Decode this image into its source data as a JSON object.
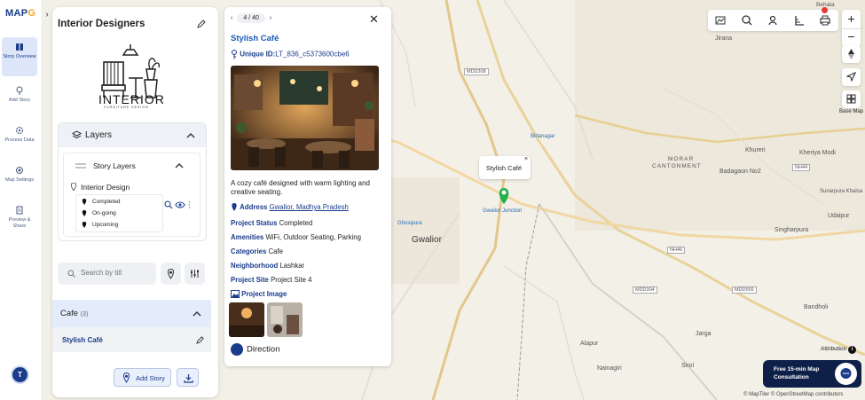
{
  "app": {
    "logo_text": "MAP",
    "logo_accent": "G",
    "logo_after": ""
  },
  "rail": {
    "items": [
      {
        "label": "Story Overview",
        "icon": "book-icon"
      },
      {
        "label": "Add Story",
        "icon": "pin-icon"
      },
      {
        "label": "Process Data",
        "icon": "gear-icon"
      },
      {
        "label": "Map Settings",
        "icon": "settings-icon"
      },
      {
        "label": "Preview & Share",
        "icon": "document-icon"
      }
    ],
    "avatar_initial": "T"
  },
  "panel": {
    "title": "Interior Designers",
    "brand_text": "INTERIOR",
    "brand_subtext": "FURNITURE DESIGN",
    "layers_label": "Layers",
    "story_layers_label": "Story Layers",
    "layer_name": "Interior Design",
    "statuses": [
      "Completed",
      "On-going",
      "Upcoming"
    ],
    "search_placeholder": "Search by titl",
    "category": {
      "name": "Cafe",
      "count": "(3)"
    },
    "category_item": "Stylish Café",
    "add_story_label": "Add Story"
  },
  "card": {
    "page_current": "4",
    "page_total": "40",
    "page_text": "4 / 40",
    "title": "Stylish Café",
    "uid_label": "Unique ID:",
    "uid_value": "LT_836_c5373600cbe6",
    "description": "A cozy café designed with warm lighting and creative seating.",
    "fields": [
      {
        "key": "Address",
        "value": "Gwalior, Madhya Pradesh"
      },
      {
        "key": "Project Status",
        "value": "Completed"
      },
      {
        "key": "Amenities",
        "value": "WiFi, Outdoor Seating, Parking"
      },
      {
        "key": "Categories",
        "value": "Cafe"
      },
      {
        "key": "Neighborhood",
        "value": "Lashkar"
      },
      {
        "key": "Project Site",
        "value": "Project Site 4"
      }
    ],
    "project_image_label": "Project Image",
    "direction_label": "Direction"
  },
  "map": {
    "popup_label": "Stylish Café",
    "labels": [
      {
        "text": "Behata"
      },
      {
        "text": "Jirana"
      },
      {
        "text": "MDD308"
      },
      {
        "text": "Birlanagar"
      },
      {
        "text": "Khureri"
      },
      {
        "text": "MORAR"
      },
      {
        "text": "CANTONMENT"
      },
      {
        "text": "Kheriya Modi"
      },
      {
        "text": "Badagaon No2"
      },
      {
        "text": "Sunarpura Khalsa"
      },
      {
        "text": "Udaipur"
      },
      {
        "text": "Singharpura"
      },
      {
        "text": "Gwalior Junction"
      },
      {
        "text": "Ghosipura"
      },
      {
        "text": "Gwalior"
      },
      {
        "text": "Bandholi"
      },
      {
        "text": "Jarga"
      },
      {
        "text": "Alapur"
      },
      {
        "text": "Nainagiri"
      },
      {
        "text": "Sirol"
      },
      {
        "text": "MDD304"
      },
      {
        "text": "NH44"
      },
      {
        "text": "NH46"
      },
      {
        "text": "MDD565"
      }
    ],
    "basemap_label": "Base Map",
    "attribution_label": "Attribution",
    "consult_line1": "Free 15-min Map",
    "consult_line2": "Consultation",
    "copyright": "© MapTiler © OpenStreetMap contributors"
  },
  "colors": {
    "brand": "#1a3c8a",
    "marker": "#22b14c",
    "accent": "#f5a623"
  }
}
